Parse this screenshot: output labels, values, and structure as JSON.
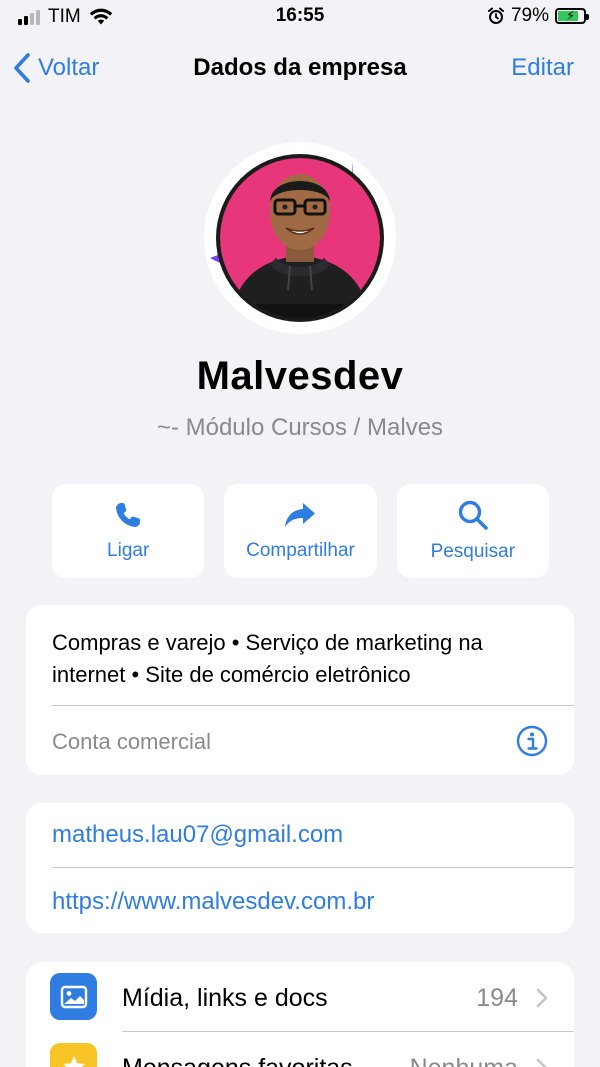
{
  "status_bar": {
    "carrier": "TIM",
    "time": "16:55",
    "battery_percent": "79%",
    "battery_level": 0.79,
    "charging": true,
    "icons": [
      "signal-icon",
      "wifi-icon",
      "alarm-icon",
      "battery-icon"
    ]
  },
  "nav": {
    "back_label": "Voltar",
    "title": "Dados da empresa",
    "edit_label": "Editar"
  },
  "profile": {
    "name": "Malvesdev",
    "subtitle": "~- Módulo Cursos / Malves",
    "avatar_bg_color": "#e8367a",
    "ring_color": "#7b3ff2"
  },
  "actions": [
    {
      "label": "Ligar",
      "icon": "phone-icon"
    },
    {
      "label": "Compartilhar",
      "icon": "share-icon"
    },
    {
      "label": "Pesquisar",
      "icon": "search-icon"
    }
  ],
  "business_info": {
    "description": "Compras e varejo • Serviço de marketing na internet • Site de comércio eletrônico",
    "account_type": "Conta comercial",
    "info_icon": "info-icon"
  },
  "contact": {
    "email": "matheus.lau07@gmail.com",
    "website": "https://www.malvesdev.com.br"
  },
  "media": [
    {
      "label": "Mídia, links e docs",
      "value": "194",
      "icon": "photo-icon",
      "icon_color": "#2f7de1"
    },
    {
      "label": "Mensagens favoritas",
      "value": "Nenhuma",
      "icon": "star-icon",
      "icon_color": "#f7c325"
    }
  ],
  "colors": {
    "accent": "#2f7de1",
    "background": "#f2f2f7",
    "secondary_text": "#8a8a8e"
  }
}
